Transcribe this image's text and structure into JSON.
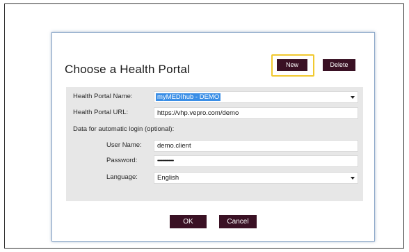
{
  "dialog": {
    "title": "Choose a Health Portal",
    "new_label": "New",
    "delete_label": "Delete",
    "ok_label": "OK",
    "cancel_label": "Cancel"
  },
  "form": {
    "portal_name_label": "Health Portal Name:",
    "portal_name_value": "myMEDIhub - DEMO",
    "portal_url_label": "Health Portal URL:",
    "portal_url_value": "https://vhp.vepro.com/demo",
    "autologin_label": "Data for automatic login (optional):",
    "username_label": "User Name:",
    "username_value": "demo.client",
    "password_label": "Password:",
    "password_value": "••••••••••••••••",
    "language_label": "Language:",
    "language_value": "English"
  },
  "colors": {
    "button_bg": "#3a1124",
    "highlight": "#f1c92f",
    "selection": "#3a8ee6",
    "panel_bg": "#e7e7e7"
  },
  "icons": {
    "dropdown": "chevron-down-icon"
  }
}
